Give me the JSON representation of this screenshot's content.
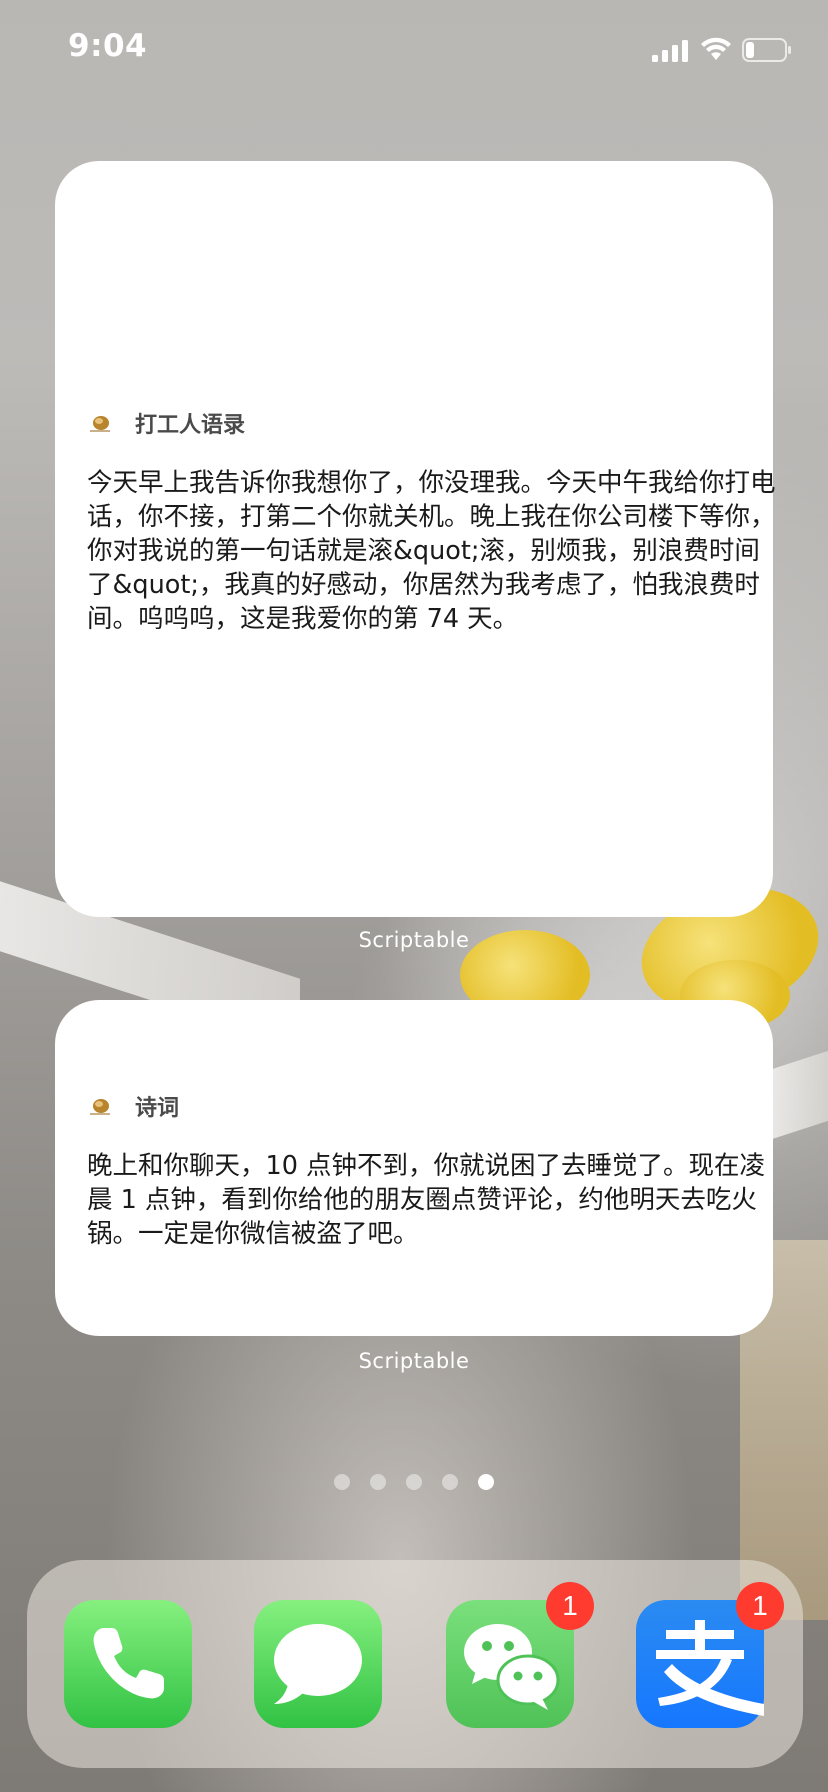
{
  "status_bar": {
    "time": "9:04"
  },
  "widgets": [
    {
      "title": "打工人语录",
      "body": "今天早上我告诉你我想你了，你没理我。今天中午我给你打电话，你不接，打第二个你就关机。晚上我在你公司楼下等你，你对我说的第一句话就是滚&quot;滚，别烦我，别浪费时间了&quot;，我真的好感动，你居然为我考虑了，怕我浪费时间。呜呜呜，这是我爱你的第 74 天。",
      "label": "Scriptable"
    },
    {
      "title": "诗词",
      "body": "晚上和你聊天，10 点钟不到，你就说困了去睡觉了。现在凌晨 1 点钟，看到你给他的朋友圈点赞评论，约他明天去吃火锅。一定是你微信被盗了吧。",
      "label": "Scriptable"
    }
  ],
  "page_dots": {
    "count": 5,
    "active_index": 4
  },
  "dock": {
    "apps": [
      {
        "name": "Phone",
        "icon": "phone-icon"
      },
      {
        "name": "Messages",
        "icon": "messages-icon"
      },
      {
        "name": "WeChat",
        "icon": "wechat-icon",
        "badge": "1"
      },
      {
        "name": "Alipay",
        "icon": "alipay-icon",
        "badge": "1"
      }
    ]
  },
  "colors": {
    "badge": "#ff3b30",
    "green": "#34c759",
    "alipay_blue": "#1677ff"
  }
}
